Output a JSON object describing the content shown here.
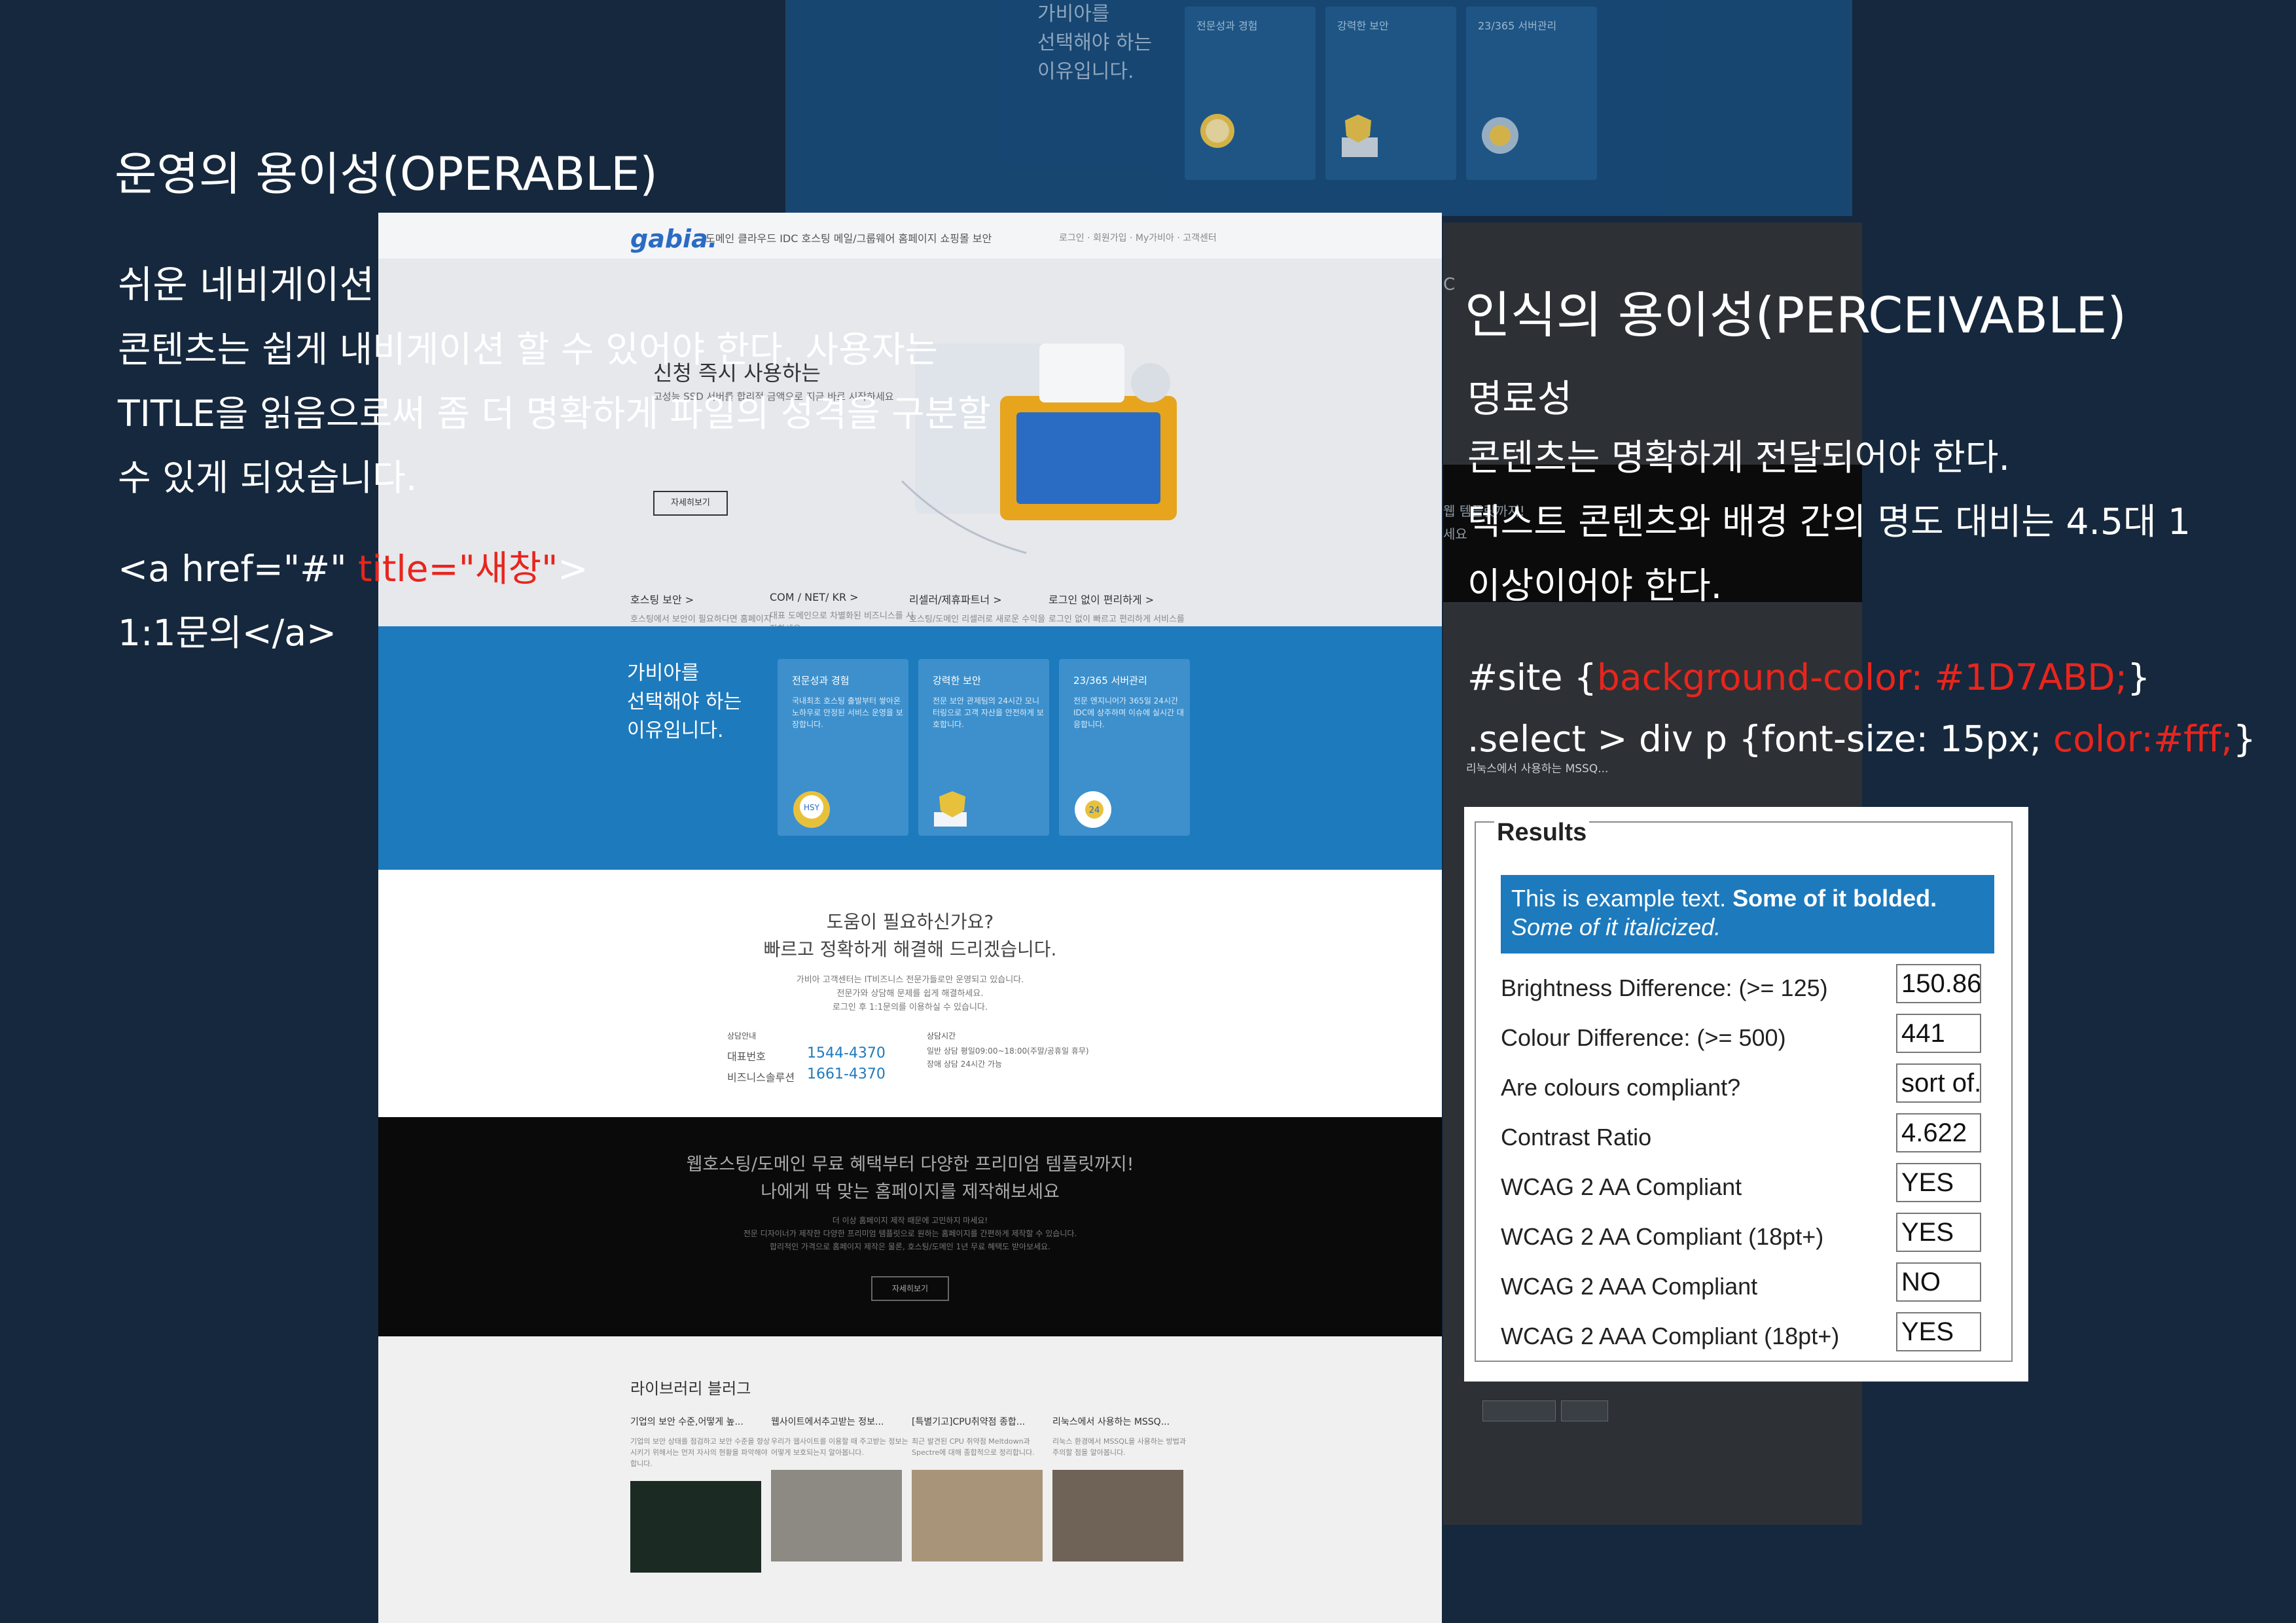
{
  "left": {
    "heading": "운영의 용이성(OPERABLE)",
    "subheading": "쉬운 네비게이션",
    "paragraph_lines": [
      "콘텐츠는 쉽게 내비게이션 할 수 있어야 한다. 사용자는",
      "TITLE을 읽음으로써 좀 더 명확하게 파일의 성격을 구분할",
      "수 있게 되었습니다."
    ],
    "code_prefix": "<a href=\"#\" ",
    "code_highlight": "title=\"새창\"",
    "code_suffix": ">",
    "code_line2": "1:1문의</a>"
  },
  "right": {
    "heading": "인식의 용이성(PERCEIVABLE)",
    "subheading": "명료성",
    "paragraph_lines": [
      "콘텐츠는 명확하게 전달되어야 한다.",
      "텍스트 콘텐츠와 배경 간의 명도 대비는 4.5대 1",
      "이상이어야 한다."
    ],
    "css1_prefix": "#site {",
    "css1_highlight": "background-color: #1D7ABD;",
    "css1_suffix": "}",
    "css2_prefix": ".select > div p {font-size: 15px; ",
    "css2_highlight": "color:#fff;",
    "css2_suffix": "}"
  },
  "results": {
    "legend": "Results",
    "sample_line1_normal": "This is example text. ",
    "sample_line1_bold": "Some of it bolded.",
    "sample_line2_italic": "Some of it italicized.",
    "rows": [
      {
        "label": "Brightness Difference: (>= 125)",
        "value": "150.86"
      },
      {
        "label": "Colour Difference: (>= 500)",
        "value": "441"
      },
      {
        "label": "Are colours compliant?",
        "value": "sort of."
      },
      {
        "label": "Contrast Ratio",
        "value": "4.622"
      },
      {
        "label": "WCAG 2 AA Compliant",
        "value": "YES"
      },
      {
        "label": "WCAG 2 AA Compliant (18pt+)",
        "value": "YES"
      },
      {
        "label": "WCAG 2 AAA Compliant",
        "value": "NO"
      },
      {
        "label": "WCAG 2 AAA Compliant (18pt+)",
        "value": "YES"
      }
    ]
  },
  "website": {
    "logo": "gabia.",
    "nav_items": "도메인   클라우드   IDC   호스팅   메일/그룹웨어   홈페이지   쇼핑몰   보안",
    "utility_links": "로그인 · 회원가입 · My가비아 · 고객센터",
    "hero_title": "신청 즉시 사용하는",
    "hero_sub": "고성능 SSD 서버를 합리적 금액으로 지금 바로 시작하세요",
    "hero_button": "자세히보기",
    "features": [
      {
        "title": "호스팅 보안 >",
        "desc": "호스팅에서 보안이 필요하다면 홈페이지를 안전하게 지켜드립니다."
      },
      {
        "title": "COM / NET/ KR >",
        "desc": "대표 도메인으로 차별화된 비즈니스를 시작하세요."
      },
      {
        "title": "리셀러/제휴파트너 >",
        "desc": "호스팅/도메인 리셀러로 새로운 수익을 창출하세요."
      },
      {
        "title": "로그인 없이 편리하게 >",
        "desc": "로그인 없이 빠르고 편리하게 서비스를 이용하세요."
      }
    ],
    "blue_title_lines": [
      "가비아를",
      "선택해야 하는",
      "이유입니다."
    ],
    "cards": [
      {
        "title": "전문성과 경험",
        "desc": "국내최초 호스팅 출발부터 쌓아온 노하우로 안정된 서비스 운영을 보장합니다.",
        "icon": "hsy-badge-icon",
        "badge": "HSY"
      },
      {
        "title": "강력한 보안",
        "desc": "전문 보안 관제팀의 24시간 모니터링으로 고객 자산을 안전하게 보호합니다.",
        "icon": "shield-server-icon",
        "badge": ""
      },
      {
        "title": "23/365 서버관리",
        "desc": "전문 엔지니어가 365일 24시간 IDC에 상주하며 이슈에 실시간 대응합니다.",
        "icon": "support-24-icon",
        "badge": "24"
      }
    ],
    "help_title1": "도움이 필요하신가요?",
    "help_title2": "빠르고 정확하게 해결해 드리겠습니다.",
    "help_desc_lines": [
      "가비아 고객센터는 IT비즈니스 전문가들로만 운영되고 있습니다.",
      "전문가와 상담해 문제를 쉽게 해결하세요.",
      "로그인 후 1:1문의를 이용하실 수 있습니다."
    ],
    "contact_label": "상담안내",
    "rep_label": "대표번호",
    "rep_phone": "1544-4370",
    "biz_label": "비즈니스솔루션",
    "biz_phone": "1661-4370",
    "hours_label": "상담시간",
    "hours_text": "일반 상담 평일09:00~18:00(주말/공휴일 휴무)",
    "hours_text2": "장애 상담 24시간 가능",
    "dark_title1": "웹호스팅/도메인 무료 혜택부터 다양한 프리미엄 템플릿까지!",
    "dark_title2": "나에게 딱 맞는 홈페이지를 제작해보세요",
    "dark_desc_lines": [
      "더 이상 홈페이지 제작 때문에 고민하지 마세요!",
      "전문 디자이너가 제작한 다양한 프리미엄 템플릿으로 원하는 홈페이지를 간편하게 제작할 수 있습니다.",
      "합리적인 가격으로 홈페이지 제작은 물론, 호스팅/도메인 1년 무료 혜택도 받아보세요."
    ],
    "dark_button": "자세히보기",
    "blog_title": "라이브러리 블러그",
    "posts": [
      {
        "title": "기업의 보안 수준,어떻게 높...",
        "desc": "기업의 보안 상태를 점검하고 보안 수준을 향상시키기 위해서는 먼저 자사의 현황을 파악해야 합니다."
      },
      {
        "title": "웹사이트에서추고받는 정보...",
        "desc": "우리가 웹사이트를 이용할 때 주고받는 정보는 어떻게 보호되는지 알아봅니다."
      },
      {
        "title": "[특별기고]CPU취약점 종합...",
        "desc": "최근 발견된 CPU 취약점 Meltdown과 Spectre에 대해 종합적으로 정리합니다."
      },
      {
        "title": "리눅스에서 사용하는 MSSQ...",
        "desc": "리눅스 환경에서 MSSQL을 사용하는 방법과 주의할 점을 알아봅니다."
      }
    ]
  },
  "topband": {
    "title_lines": [
      "가비아를",
      "선택해야 하는",
      "이유입니다."
    ],
    "cards": [
      "전문성과 경험",
      "강력한 보안",
      "23/365 서버관리"
    ]
  },
  "rightpanel": {
    "frag1": "웹 템플릿까지!",
    "frag2": "세요",
    "frag3": "리눅스에서 사용하는 MSSQ...",
    "frag4": "C"
  }
}
